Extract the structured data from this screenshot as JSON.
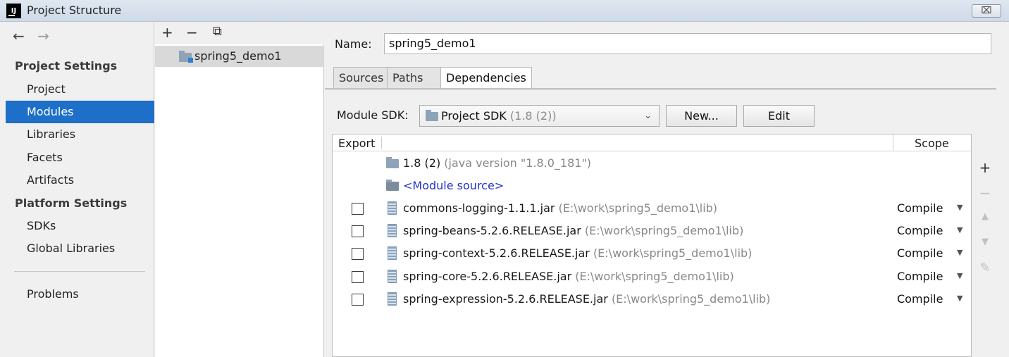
{
  "window": {
    "title": "Project Structure",
    "logo_text": "IJ",
    "close_label": "⌧"
  },
  "nav": {
    "back": "←",
    "forward": "→",
    "project_settings_heading": "Project Settings",
    "project_items": [
      "Project",
      "Modules",
      "Libraries",
      "Facets",
      "Artifacts"
    ],
    "platform_settings_heading": "Platform Settings",
    "platform_items": [
      "SDKs",
      "Global Libraries"
    ],
    "problems": "Problems",
    "selected": "Modules"
  },
  "tree": {
    "toolbar": {
      "add": "+",
      "remove": "−",
      "copy": "⧉"
    },
    "modules": [
      "spring5_demo1"
    ]
  },
  "module": {
    "name_label": "Name:",
    "name_value": "spring5_demo1",
    "tabs": [
      "Sources",
      "Paths",
      "Dependencies"
    ],
    "active_tab": "Dependencies",
    "sdk_label": "Module SDK:",
    "sdk_value": "Project SDK",
    "sdk_version": "(1.8 (2))",
    "new_button": "New...",
    "edit_button": "Edit"
  },
  "dependencies": {
    "columns": {
      "export": "Export",
      "scope": "Scope"
    },
    "sdk_row": {
      "name": "1.8 (2)",
      "detail": "(java version \"1.8.0_181\")"
    },
    "module_source": "<Module source>",
    "rows": [
      {
        "name": "commons-logging-1.1.1.jar",
        "path": "(E:\\work\\spring5_demo1\\lib)",
        "scope": "Compile",
        "exported": false
      },
      {
        "name": "spring-beans-5.2.6.RELEASE.jar",
        "path": "(E:\\work\\spring5_demo1\\lib)",
        "scope": "Compile",
        "exported": false
      },
      {
        "name": "spring-context-5.2.6.RELEASE.jar",
        "path": "(E:\\work\\spring5_demo1\\lib)",
        "scope": "Compile",
        "exported": false
      },
      {
        "name": "spring-core-5.2.6.RELEASE.jar",
        "path": "(E:\\work\\spring5_demo1\\lib)",
        "scope": "Compile",
        "exported": false
      },
      {
        "name": "spring-expression-5.2.6.RELEASE.jar",
        "path": "(E:\\work\\spring5_demo1\\lib)",
        "scope": "Compile",
        "exported": false
      }
    ],
    "side_buttons": {
      "add": "+",
      "remove": "−",
      "up": "▲",
      "down": "▼",
      "edit": "✎"
    }
  },
  "colors": {
    "selection": "#1e6fc8",
    "link": "#2233cc",
    "muted": "#888888"
  }
}
